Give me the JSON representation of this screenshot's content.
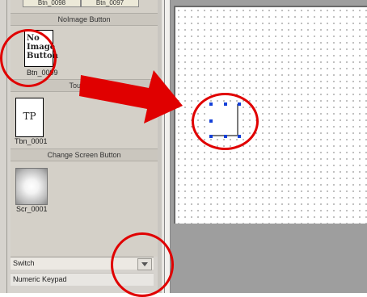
{
  "palette": {
    "tabs": [
      "Btn_0098",
      "Btn_0097"
    ],
    "sections": {
      "noimage_header": "NoImage Button",
      "touch_header": "Touch Sc",
      "change_screen_header": "Change Screen Button"
    },
    "items": {
      "noimage_tile_text": [
        "No",
        "Image",
        "Button"
      ],
      "noimage_caption": "Btn_0099",
      "touch_tile_text": "TP",
      "touch_caption": "Tbn_0001",
      "change_screen_caption": "Scr_0001"
    }
  },
  "bottom_list": {
    "switch_label": "Switch",
    "numeric_label": "Numeric Keypad"
  },
  "colors": {
    "highlight": "#e00000",
    "selection_handle": "#1440d8"
  },
  "icons": [
    "chevron-down-icon",
    "red-arrow-icon"
  ]
}
